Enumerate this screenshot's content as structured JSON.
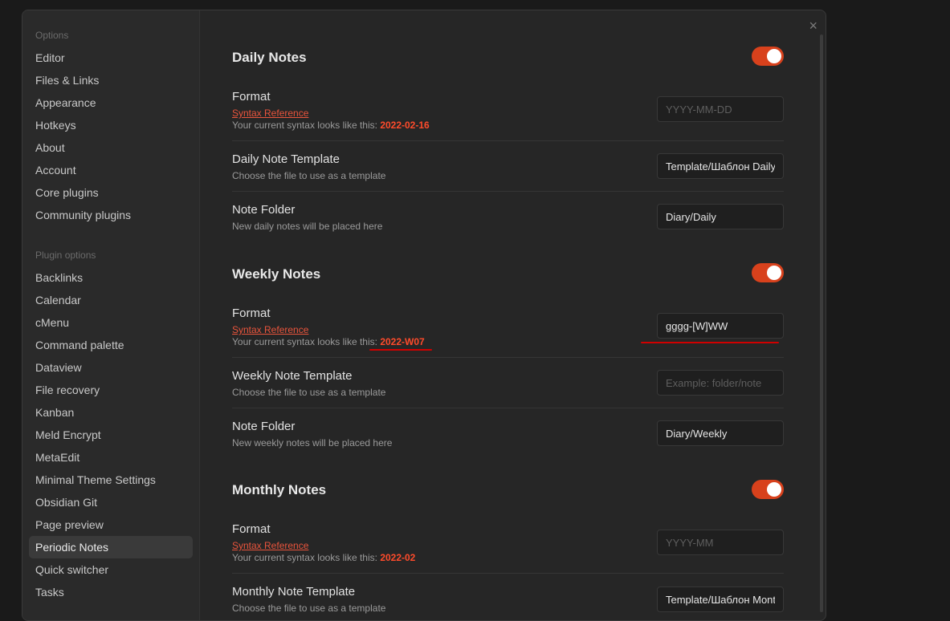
{
  "sidebar": {
    "options_heading": "Options",
    "options": [
      {
        "label": "Editor"
      },
      {
        "label": "Files & Links"
      },
      {
        "label": "Appearance"
      },
      {
        "label": "Hotkeys"
      },
      {
        "label": "About"
      },
      {
        "label": "Account"
      },
      {
        "label": "Core plugins"
      },
      {
        "label": "Community plugins"
      }
    ],
    "plugin_heading": "Plugin options",
    "plugins": [
      {
        "label": "Backlinks"
      },
      {
        "label": "Calendar"
      },
      {
        "label": "cMenu"
      },
      {
        "label": "Command palette"
      },
      {
        "label": "Dataview"
      },
      {
        "label": "File recovery"
      },
      {
        "label": "Kanban"
      },
      {
        "label": "Meld Encrypt"
      },
      {
        "label": "MetaEdit"
      },
      {
        "label": "Minimal Theme Settings"
      },
      {
        "label": "Obsidian Git"
      },
      {
        "label": "Page preview"
      },
      {
        "label": "Periodic Notes"
      },
      {
        "label": "Quick switcher"
      },
      {
        "label": "Tasks"
      }
    ],
    "active_item": "Periodic Notes"
  },
  "close_glyph": "×",
  "daily": {
    "title": "Daily Notes",
    "enabled": true,
    "format": {
      "name": "Format",
      "link": "Syntax Reference",
      "preview_prefix": "Your current syntax looks like this: ",
      "preview_value": "2022-02-16",
      "value": "",
      "placeholder": "YYYY-MM-DD"
    },
    "template": {
      "name": "Daily Note Template",
      "desc": "Choose the file to use as a template",
      "value": "Template/Шаблон Daily",
      "placeholder": ""
    },
    "folder": {
      "name": "Note Folder",
      "desc": "New daily notes will be placed here",
      "value": "Diary/Daily",
      "placeholder": ""
    }
  },
  "weekly": {
    "title": "Weekly Notes",
    "enabled": true,
    "format": {
      "name": "Format",
      "link": "Syntax Reference",
      "preview_prefix": "Your current syntax looks like this: ",
      "preview_value": "2022-W07",
      "value": "gggg-[W]WW",
      "placeholder": ""
    },
    "template": {
      "name": "Weekly Note Template",
      "desc": "Choose the file to use as a template",
      "value": "",
      "placeholder": "Example: folder/note"
    },
    "folder": {
      "name": "Note Folder",
      "desc": "New weekly notes will be placed here",
      "value": "Diary/Weekly",
      "placeholder": ""
    }
  },
  "monthly": {
    "title": "Monthly Notes",
    "enabled": true,
    "format": {
      "name": "Format",
      "link": "Syntax Reference",
      "preview_prefix": "Your current syntax looks like this: ",
      "preview_value": "2022-02",
      "value": "",
      "placeholder": "YYYY-MM"
    },
    "template": {
      "name": "Monthly Note Template",
      "desc": "Choose the file to use as a template",
      "value": "Template/Шаблон Monthly",
      "placeholder": ""
    }
  },
  "colors": {
    "accent": "#d8411c",
    "syntax_value": "#ff4b2b",
    "link": "#e9543c",
    "annotation": "#d00000"
  }
}
